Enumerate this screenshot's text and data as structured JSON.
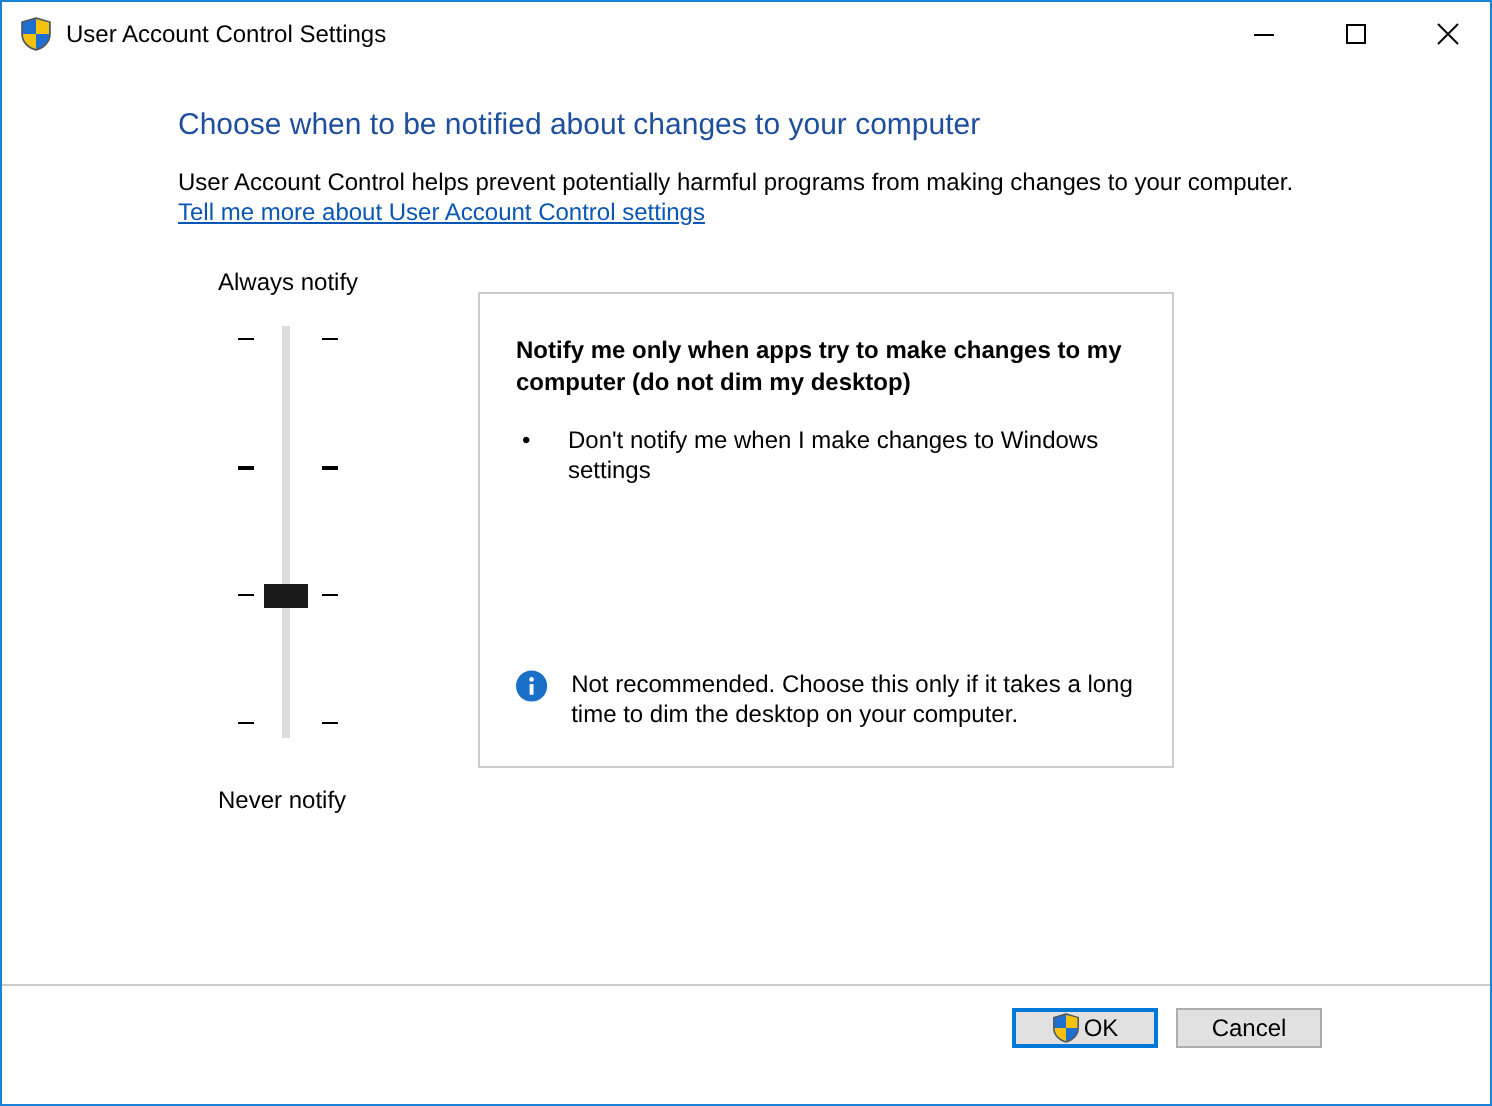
{
  "window": {
    "title": "User Account Control Settings"
  },
  "heading": "Choose when to be notified about changes to your computer",
  "description": "User Account Control helps prevent potentially harmful programs from making changes to your computer.",
  "link": "Tell me more about User Account Control settings",
  "slider": {
    "top_label": "Always notify",
    "bottom_label": "Never notify",
    "level": 0.3333
  },
  "details": {
    "title": "Notify me only when apps try to make changes to my computer (do not dim my desktop)",
    "bullets": [
      {
        "marker": "•",
        "text": "Don't notify me when I make changes to Windows settings"
      }
    ],
    "note": "Not recommended. Choose this only if it takes a long time to dim the desktop on your computer."
  },
  "buttons": [
    {
      "label": "OK",
      "kind": "shield",
      "default": true
    },
    {
      "label": "Cancel",
      "kind": "plain",
      "default": false
    }
  ]
}
